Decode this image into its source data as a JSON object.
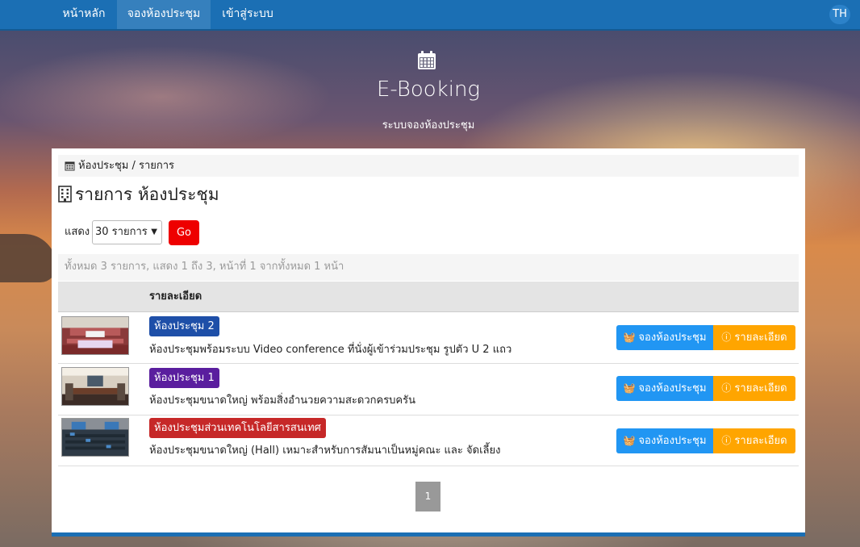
{
  "nav": {
    "home": "หน้าหลัก",
    "booking": "จองห้องประชุม",
    "login": "เข้าสู่ระบบ",
    "lang": "TH"
  },
  "hero": {
    "title": "E-Booking",
    "subtitle": "ระบบจองห้องประชุม"
  },
  "breadcrumb": "ห้องประชุม / รายการ",
  "page_title": "รายการ ห้องประชุม",
  "filter": {
    "label": "แสดง",
    "selected": "30 รายการ",
    "go": "Go"
  },
  "summary": "ทั้งหมด 3 รายการ, แสดง 1 ถึง 3, หน้าที่ 1 จากทั้งหมด 1 หน้า",
  "table": {
    "header_detail": "รายละเอียด",
    "rows": [
      {
        "name": "ห้องประชุม 2",
        "badge_color": "#1e4fa8",
        "description": "ห้องประชุมพร้อมระบบ Video conference ที่นั่งผู้เข้าร่วมประชุม รูปตัว U 2 แถว",
        "book": "จองห้องประชุม",
        "detail": "รายละเอียด"
      },
      {
        "name": "ห้องประชุม 1",
        "badge_color": "#5a1e9e",
        "description": "ห้องประชุมขนาดใหญ่ พร้อมสิ่งอำนวยความสะดวกครบครัน",
        "book": "จองห้องประชุม",
        "detail": "รายละเอียด"
      },
      {
        "name": "ห้องประชุมส่วนเทคโนโลยีสารสนเทศ",
        "badge_color": "#c62828",
        "description": "ห้องประชุมขนาดใหญ่ (Hall) เหมาะสำหรับการสัมนาเป็นหมู่คณะ และ จัดเลี้ยง",
        "book": "จองห้องประชุม",
        "detail": "รายละเอียด"
      }
    ]
  },
  "pagination": {
    "current": "1"
  },
  "colors": {
    "navbar": "#1b6fb4",
    "go_button": "#e00000",
    "book_button": "#2196f3",
    "detail_button": "#ffa500"
  },
  "icons": {
    "hero": "calendar-icon",
    "breadcrumb": "calendar-icon",
    "title": "building-icon",
    "book": "basket-icon",
    "detail": "info-circle-icon"
  }
}
